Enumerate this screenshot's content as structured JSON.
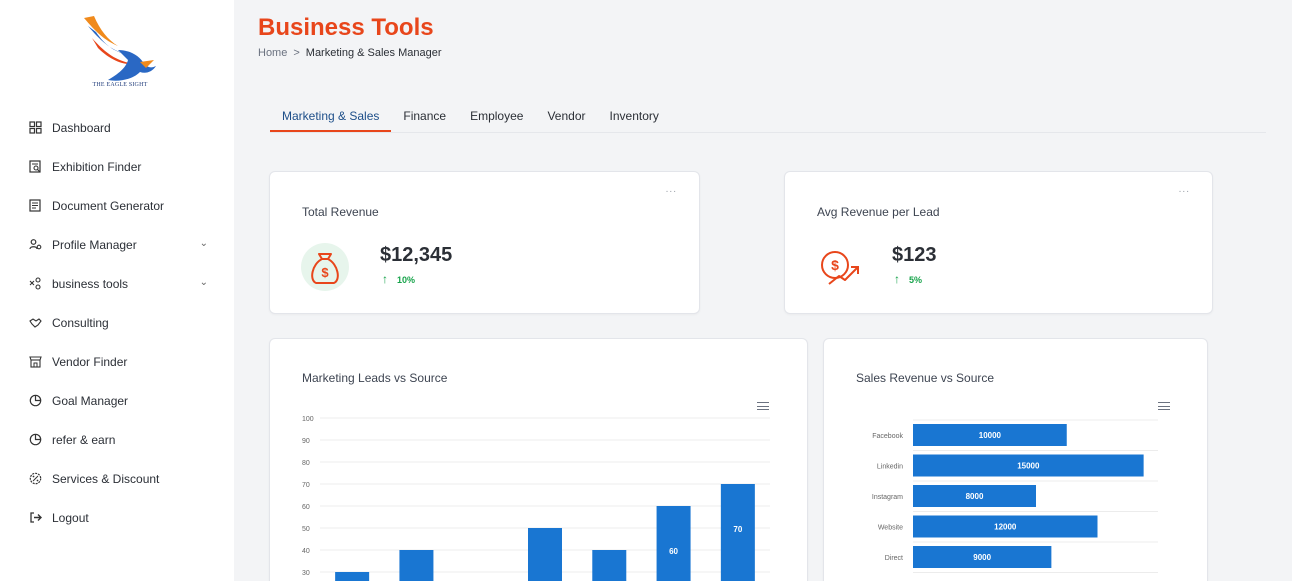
{
  "brand": {
    "logo_text": "THE EAGLE SIGHT",
    "accent": "#e8461b",
    "primary": "#1976d2"
  },
  "sidebar": {
    "items": [
      {
        "label": "Dashboard",
        "icon": "grid-icon"
      },
      {
        "label": "Exhibition Finder",
        "icon": "search-document-icon"
      },
      {
        "label": "Document Generator",
        "icon": "document-icon"
      },
      {
        "label": "Profile Manager",
        "icon": "users-icon",
        "expandable": true
      },
      {
        "label": "business tools",
        "icon": "network-icon",
        "expandable": true
      },
      {
        "label": "Consulting",
        "icon": "handshake-icon"
      },
      {
        "label": "Vendor Finder",
        "icon": "store-icon"
      },
      {
        "label": "Goal Manager",
        "icon": "goal-icon"
      },
      {
        "label": "refer & earn",
        "icon": "refer-icon"
      },
      {
        "label": "Services & Discount",
        "icon": "discount-icon"
      },
      {
        "label": "Logout",
        "icon": "logout-icon"
      }
    ]
  },
  "header": {
    "title": "Business Tools",
    "breadcrumb": {
      "home": "Home",
      "separator": ">",
      "current": "Marketing & Sales Manager"
    }
  },
  "tabs": [
    {
      "label": "Marketing & Sales",
      "active": true
    },
    {
      "label": "Finance"
    },
    {
      "label": "Employee"
    },
    {
      "label": "Vendor"
    },
    {
      "label": "Inventory"
    }
  ],
  "kpis": {
    "total_revenue": {
      "title": "Total Revenue",
      "value": "$12,345",
      "change": "10%",
      "more": "..."
    },
    "avg_revenue": {
      "title": "Avg Revenue per Lead",
      "value": "$123",
      "change": "5%",
      "more": "..."
    }
  },
  "charts": {
    "leads": {
      "title": "Marketing Leads vs Source"
    },
    "sales": {
      "title": "Sales Revenue vs Source"
    }
  },
  "chart_data": [
    {
      "type": "bar",
      "title": "Marketing Leads vs Source",
      "ylim": [
        0,
        100
      ],
      "yticks": [
        30,
        40,
        50,
        60,
        70,
        80,
        90,
        100
      ],
      "values": [
        30,
        40,
        null,
        50,
        40,
        60,
        70
      ],
      "data_labels": [
        "",
        "",
        "",
        "",
        "",
        "60",
        "70"
      ],
      "color": "#1976d2",
      "grid": true
    },
    {
      "type": "bar",
      "orientation": "horizontal",
      "title": "Sales Revenue vs Source",
      "categories": [
        "Facebook",
        "Linkedin",
        "Instagram",
        "Website",
        "Direct"
      ],
      "values": [
        10000,
        15000,
        8000,
        12000,
        9000
      ],
      "data_labels": [
        "10000",
        "15000",
        "8000",
        "12000",
        "9000"
      ],
      "xlim": [
        0,
        16000
      ],
      "color": "#1976d2",
      "grid": true
    }
  ]
}
